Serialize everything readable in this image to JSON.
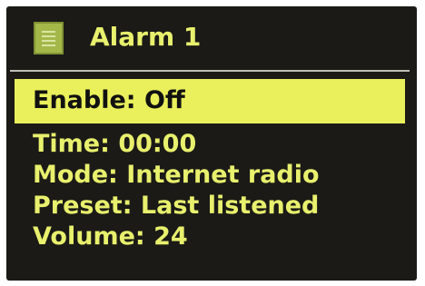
{
  "header": {
    "title": "Alarm 1",
    "icon": "menu-icon"
  },
  "menu": {
    "selected": "Enable: Off",
    "items": [
      "Time: 00:00",
      "Mode: Internet radio",
      "Preset: Last listened",
      "Volume: 24"
    ]
  },
  "colors": {
    "screen_bg": "#1b1a17",
    "highlight_bg": "#eaf05b",
    "text": "#e8f06d",
    "selected_text": "#111111",
    "divider": "#bfbfb6"
  }
}
